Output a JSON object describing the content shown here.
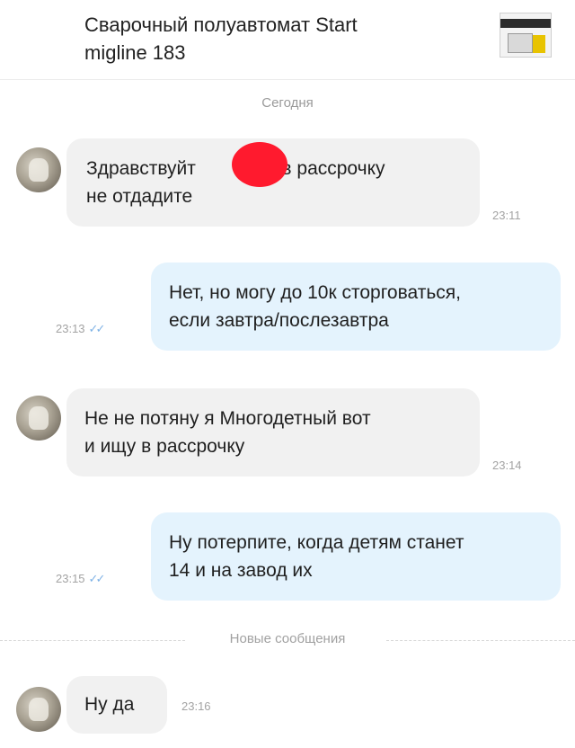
{
  "header": {
    "title_line1": "Сварочный полуавтомат Start",
    "title_line2": "migline 183"
  },
  "divider_today": "Сегодня",
  "messages": [
    {
      "from": "buyer",
      "line1": "Здравствуйт",
      "line1b": "а в рассрочку",
      "line2": "не отдадите",
      "time": "23:11"
    },
    {
      "from": "seller",
      "line1": "Нет, но могу до 10к сторговаться,",
      "line2": "если завтра/послезавтра",
      "time": "23:13"
    },
    {
      "from": "buyer",
      "line1": "Не не потяну я Многодетный вот",
      "line2": "и ищу в рассрочку",
      "time": "23:14"
    },
    {
      "from": "seller",
      "line1": "Ну потерпите, когда детям станет",
      "line2": "14 и на завод их",
      "time": "23:15"
    },
    {
      "from": "buyer",
      "line1": "Ну да",
      "time": "23:16"
    }
  ],
  "divider_new": "Новые сообщения",
  "icons": {
    "read_receipt": "double-check-icon"
  }
}
